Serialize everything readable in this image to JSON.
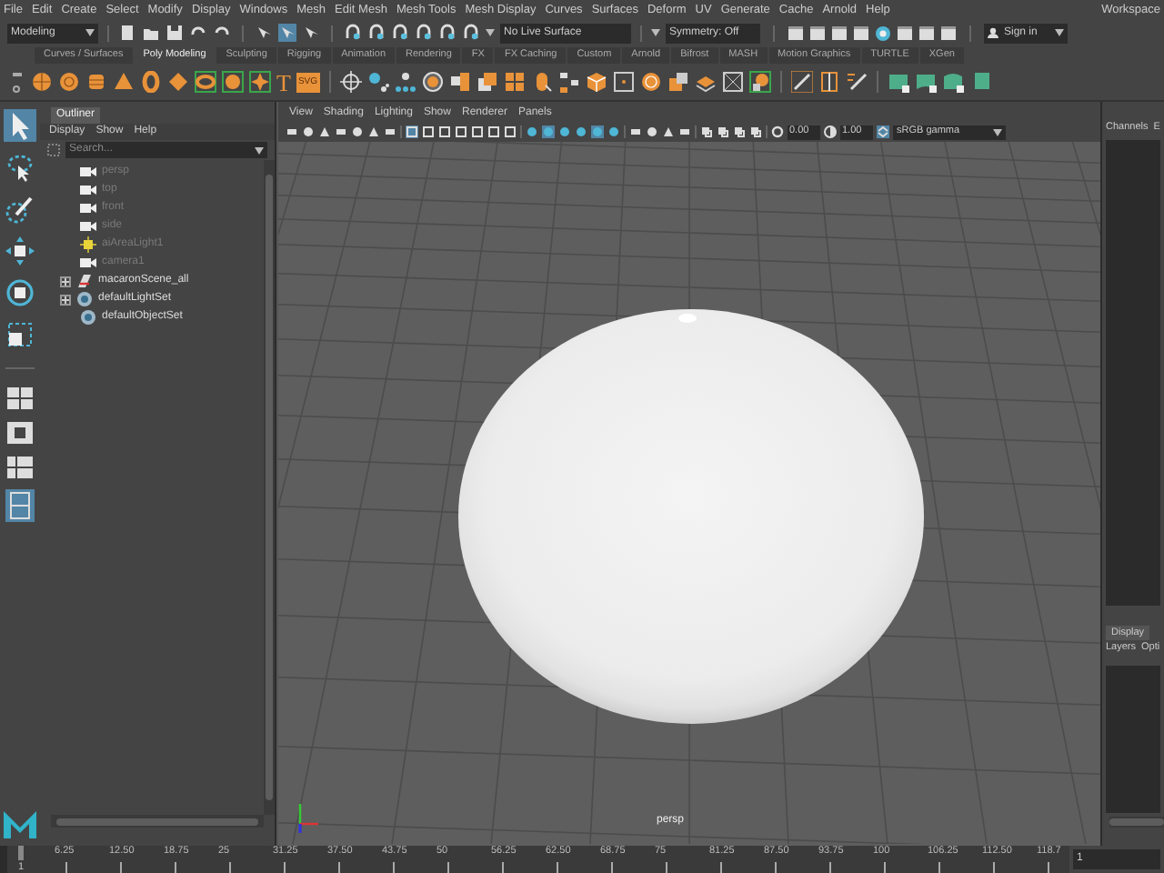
{
  "menu_bar": {
    "items": [
      "File",
      "Edit",
      "Create",
      "Select",
      "Modify",
      "Display",
      "Windows",
      "Mesh",
      "Edit Mesh",
      "Mesh Tools",
      "Mesh Display",
      "Curves",
      "Surfaces",
      "Deform",
      "UV",
      "Generate",
      "Cache",
      "Arnold",
      "Help"
    ],
    "workspace": "Workspace"
  },
  "status_line": {
    "mode": "Modeling",
    "live_surface": "No Live Surface",
    "symmetry": "Symmetry: Off",
    "sign_in": "Sign in"
  },
  "shelf": {
    "tabs": [
      {
        "label": "Curves / Surfaces",
        "selected": false
      },
      {
        "label": "Poly Modeling",
        "selected": true
      },
      {
        "label": "Sculpting",
        "selected": false
      },
      {
        "label": "Rigging",
        "selected": false
      },
      {
        "label": "Animation",
        "selected": false
      },
      {
        "label": "Rendering",
        "selected": false
      },
      {
        "label": "FX",
        "selected": false
      },
      {
        "label": "FX Caching",
        "selected": false
      },
      {
        "label": "Custom",
        "selected": false
      },
      {
        "label": "Arnold",
        "selected": false
      },
      {
        "label": "Bifrost",
        "selected": false
      },
      {
        "label": "MASH",
        "selected": false
      },
      {
        "label": "Motion Graphics",
        "selected": false
      },
      {
        "label": "TURTLE",
        "selected": false
      },
      {
        "label": "XGen",
        "selected": false
      }
    ],
    "text_buttons": [
      "T",
      "SVG"
    ]
  },
  "tool_box": {
    "tools": [
      {
        "kind": "select",
        "selected": true
      },
      {
        "kind": "lasso",
        "selected": false
      },
      {
        "kind": "paint",
        "selected": false
      },
      {
        "kind": "move",
        "selected": false
      },
      {
        "kind": "rotate",
        "selected": false
      },
      {
        "kind": "scale",
        "selected": false
      }
    ]
  },
  "outliner": {
    "title": "Outliner",
    "menus": [
      "Display",
      "Show",
      "Help"
    ],
    "search_placeholder": "Search...",
    "items": [
      {
        "label": "persp",
        "kind": "camera",
        "dimmed": true,
        "expandable": false
      },
      {
        "label": "top",
        "kind": "camera",
        "dimmed": true,
        "expandable": false
      },
      {
        "label": "front",
        "kind": "camera",
        "dimmed": true,
        "expandable": false
      },
      {
        "label": "side",
        "kind": "camera",
        "dimmed": true,
        "expandable": false
      },
      {
        "label": "aiAreaLight1",
        "kind": "light",
        "dimmed": true,
        "expandable": false
      },
      {
        "label": "camera1",
        "kind": "camera",
        "dimmed": true,
        "expandable": false
      },
      {
        "label": "macaronScene_all",
        "kind": "group",
        "dimmed": false,
        "expandable": true
      },
      {
        "label": "defaultLightSet",
        "kind": "set",
        "dimmed": false,
        "expandable": true
      },
      {
        "label": "defaultObjectSet",
        "kind": "set",
        "dimmed": false,
        "expandable": false
      }
    ]
  },
  "viewport": {
    "menus": [
      "View",
      "Shading",
      "Lighting",
      "Show",
      "Renderer",
      "Panels"
    ],
    "exposure": "0.00",
    "gamma": "1.00",
    "color_space": "sRGB gamma",
    "camera": "persp"
  },
  "channel_box": {
    "tabs": [
      "Channels",
      "E"
    ],
    "layer_tab": {
      "label": "Display",
      "selected": true
    },
    "layer_menus": [
      "Layers",
      "Opti"
    ]
  },
  "timeline": {
    "ticks": [
      "6.25",
      "12.50",
      "18.75",
      "25",
      "31.25",
      "37.50",
      "43.75",
      "50",
      "56.25",
      "62.50",
      "68.75",
      "75",
      "81.25",
      "87.50",
      "93.75",
      "100",
      "106.25",
      "112.50",
      "118.7"
    ],
    "start": "1",
    "current_frame": "1"
  }
}
